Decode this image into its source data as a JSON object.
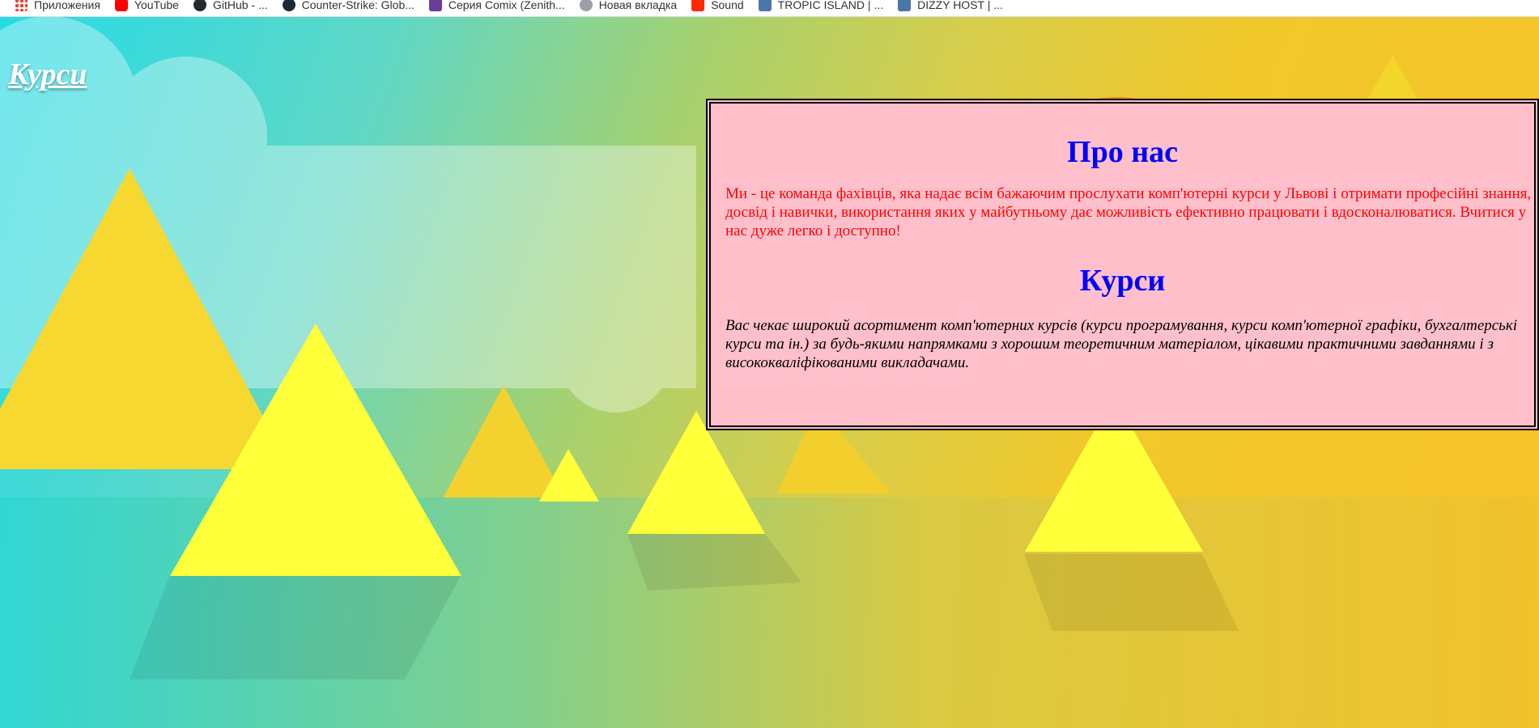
{
  "bookmarks": [
    {
      "label": "Приложения",
      "icon": "apps-icon"
    },
    {
      "label": "YouTube",
      "icon": "youtube-icon"
    },
    {
      "label": "GitHub - ...",
      "icon": "github-icon"
    },
    {
      "label": "Counter-Strike: Glob...",
      "icon": "steam-icon"
    },
    {
      "label": "Серия Comix (Zenith...",
      "icon": "book-icon"
    },
    {
      "label": "Новая вкладка",
      "icon": "new-tab-icon"
    },
    {
      "label": "Sound",
      "icon": "sound-icon"
    },
    {
      "label": "TROPIC ISLAND | ...",
      "icon": "vk-icon"
    },
    {
      "label": "DIZZY HOST | ...",
      "icon": "vk-icon"
    }
  ],
  "site": {
    "title": "Курси"
  },
  "about": {
    "heading": "Про нас",
    "text": "Ми - це команда фахівців, яка надає всім бажаючим прослухати комп'ютерні курси у Львові і отримати професійні знання, досвід і навички, використання яких у майбутньому дає можливість ефективно працювати і вдосконалюватися. Вчитися у нас дуже легко і доступно!"
  },
  "courses": {
    "heading": "Курси",
    "text": "Вас чекає широкий асортимент комп'ютерних курсів (курси програмування, курси комп'ютерної графіки, бухгалтерські курси та ін.) за будь-якими напрямками з хорошим теоретичним матеріалом, цікавими практичними завданнями і з висококваліфікованими викладачами."
  },
  "colors": {
    "panel_bg": "#ffc0cb",
    "heading": "#0000ff",
    "about_text": "#ff0000",
    "courses_text": "#000000"
  }
}
